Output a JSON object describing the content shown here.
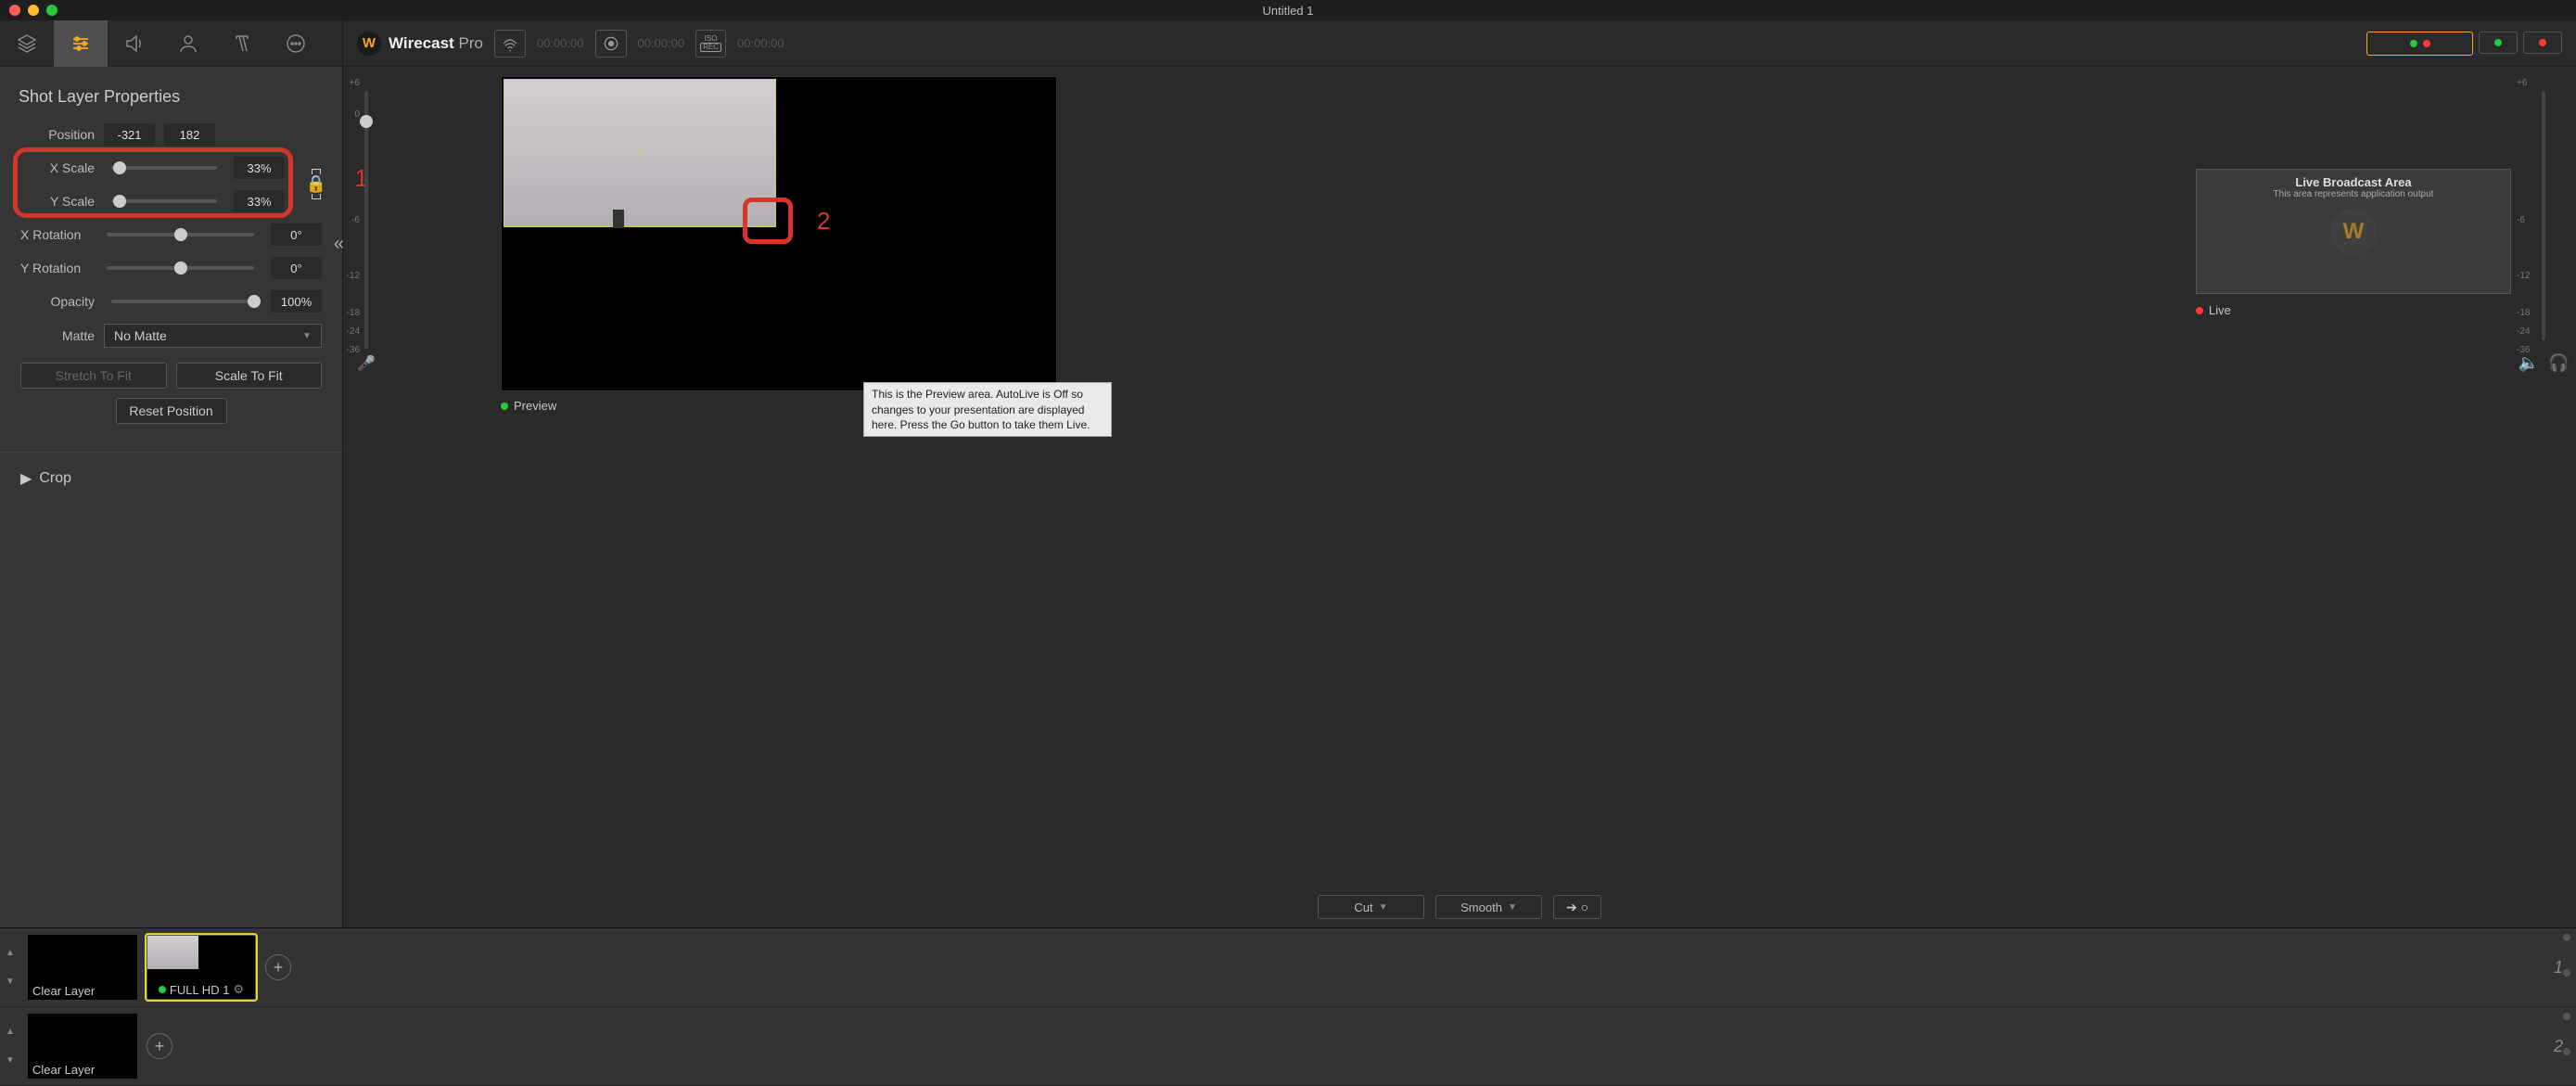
{
  "window": {
    "title": "Untitled 1"
  },
  "sidebar_tabs": [
    "layers",
    "properties",
    "audio",
    "person",
    "text",
    "more"
  ],
  "panel": {
    "title": "Shot Layer Properties",
    "position_label": "Position",
    "position_x": "-321",
    "position_y": "182",
    "xscale_label": "X Scale",
    "xscale_value": "33%",
    "yscale_label": "Y Scale",
    "yscale_value": "33%",
    "xrot_label": "X Rotation",
    "xrot_value": "0°",
    "yrot_label": "Y Rotation",
    "yrot_value": "0°",
    "opacity_label": "Opacity",
    "opacity_value": "100%",
    "matte_label": "Matte",
    "matte_value": "No Matte",
    "stretch_btn": "Stretch To Fit",
    "scale_btn": "Scale To Fit",
    "reset_btn": "Reset Position",
    "crop_label": "Crop"
  },
  "annotations": {
    "one": "1",
    "two": "2"
  },
  "topbar": {
    "brand_name": "Wirecast",
    "brand_suffix": " Pro",
    "timecodes": [
      "00:00:00",
      "00:00:00",
      "00:00:00"
    ],
    "iso_label": "ISO",
    "rec_label": "REC"
  },
  "vmeter_ticks": [
    "+6",
    "0",
    "-6",
    "-12",
    "-18",
    "-24",
    "-36"
  ],
  "preview": {
    "label": "Preview",
    "tooltip": "This is the Preview area.  AutoLive is Off so changes to your presentation are displayed here.  Press the Go button to take them Live."
  },
  "live": {
    "title": "Live Broadcast Area",
    "subtitle": "This area represents application output",
    "label": "Live"
  },
  "transition": {
    "cut": "Cut",
    "smooth": "Smooth"
  },
  "layers": {
    "clear": "Clear Layer",
    "shot1": "FULL HD 1",
    "num1": "1",
    "num2": "2"
  }
}
